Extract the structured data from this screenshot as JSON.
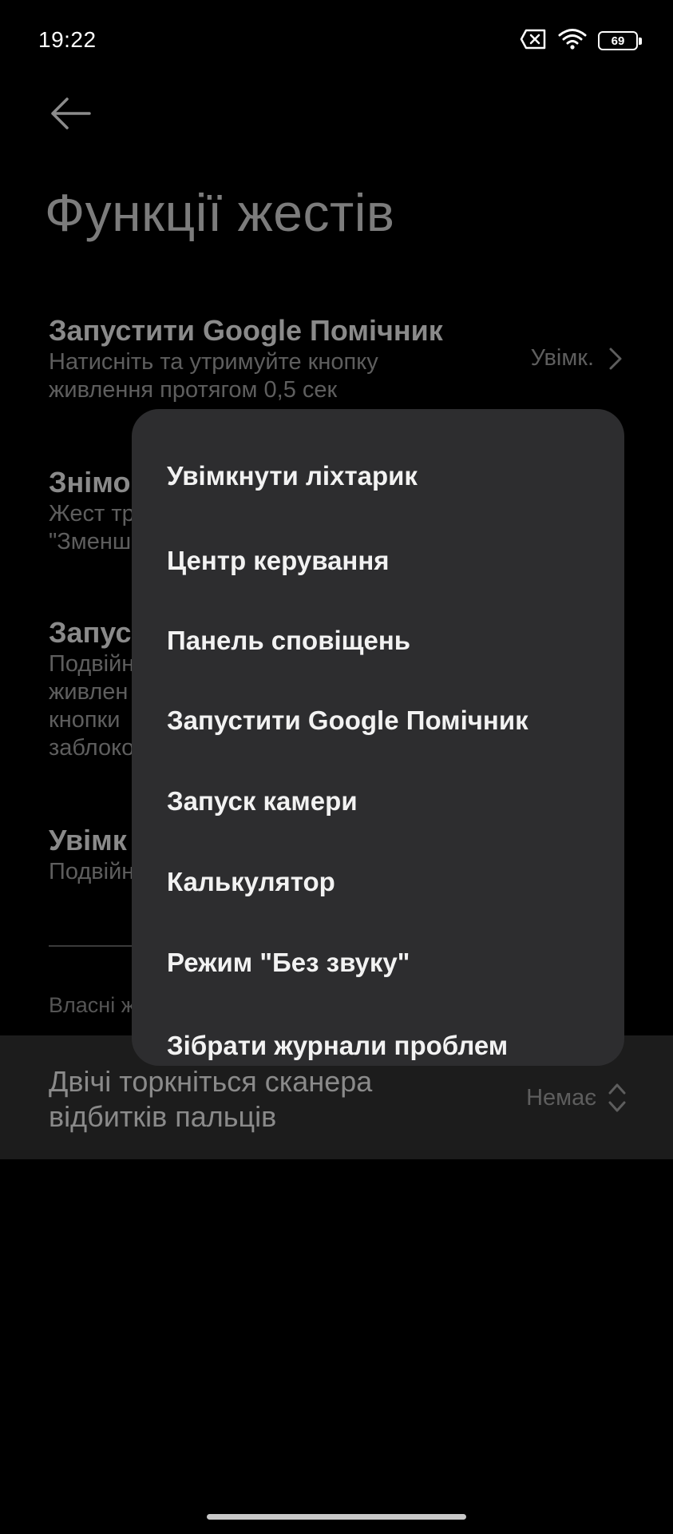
{
  "status_bar": {
    "time": "19:22",
    "battery_level": "69",
    "icons": [
      "sim-off-icon",
      "wifi-icon",
      "battery-icon"
    ]
  },
  "header": {
    "back_icon": "arrow-left-icon",
    "title": "Функції жестів"
  },
  "settings": {
    "assistant": {
      "title": "Запустити Google Помічник",
      "description": "Натисніть та утримуйте кнопку\nживлення протягом 0,5 сек",
      "value": "Увімк."
    },
    "screenshot": {
      "title": "Знімо",
      "description": "Жест тр\n\"Зменш"
    },
    "camera": {
      "title": "Запус",
      "description": "Подвійн\nживлен\nкнопки\nзаблоко"
    },
    "flashlight": {
      "title": "Увімк",
      "description": "Подвійн"
    },
    "section_label": "Власні ж"
  },
  "fingerprint": {
    "title": "Двічі торкніться сканера\nвідбитків пальців",
    "value": "Немає"
  },
  "popup_menu": {
    "items": [
      "Увімкнути ліхтарик",
      "Центр керування",
      "Панель сповіщень",
      "Запустити Google Помічник",
      "Запуск камери",
      "Калькулятор",
      "Режим \"Без звуку\"",
      "Зібрати журнали проблем"
    ]
  },
  "colors": {
    "background": "#000000",
    "popup_background": "#2d2d2f",
    "highlight_row": "#1c1c1c",
    "dimmed_text": "#8a8a8a"
  }
}
